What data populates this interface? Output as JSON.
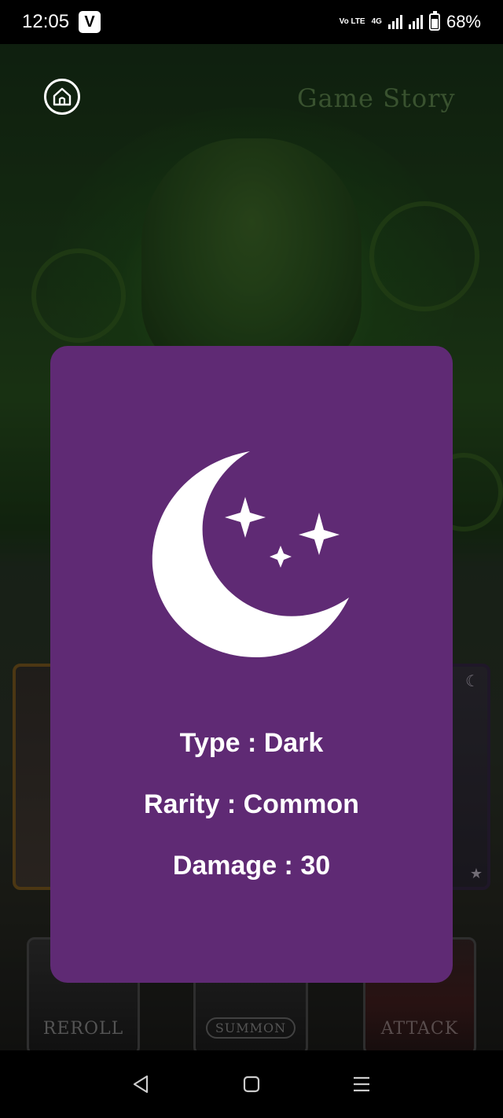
{
  "status_bar": {
    "time": "12:05",
    "app_badge": "V",
    "network_label": "Vo LTE",
    "network_type": "4G",
    "battery_percent": "68%"
  },
  "game": {
    "title": "Game Story",
    "buttons": {
      "reroll": "REROLL",
      "summon": "SUMMON",
      "attack": "ATTACK"
    }
  },
  "card_details": {
    "icon": "moon-stars-icon",
    "type_line": "Type : Dark",
    "rarity_line": "Rarity : Common",
    "damage_line": "Damage : 30"
  },
  "colors": {
    "modal_background": "#5f2a74",
    "text": "#ffffff"
  },
  "navigation": {
    "back": "back-icon",
    "home": "home-icon",
    "recents": "menu-icon"
  }
}
